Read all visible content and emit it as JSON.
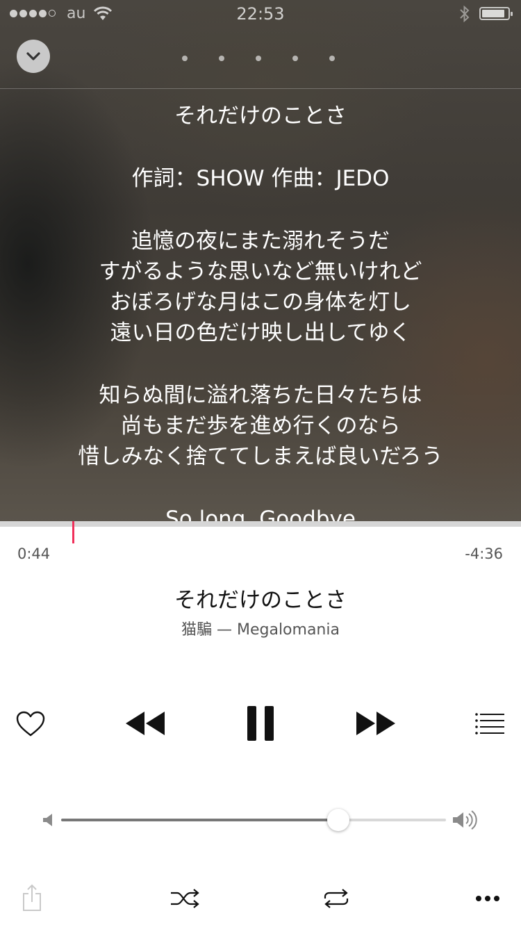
{
  "status_bar": {
    "carrier": "au",
    "time": "22:53",
    "signal_bars_filled": 4,
    "signal_bars_total": 5
  },
  "lyrics": {
    "lines": [
      "それだけのことさ",
      "",
      "作詞：SHOW 作曲：JEDO",
      "",
      "追憶の夜にまた溺れそうだ",
      "すがるような思いなど無いけれど",
      "おぼろげな月はこの身体を灯し",
      "遠い日の色だけ映し出してゆく",
      "",
      "知らぬ間に溢れ落ちた日々たちは",
      "尚もまだ歩を進め行くのなら",
      "惜しみなく捨ててしまえば良いだろう",
      "",
      "So long ,Goodbye"
    ]
  },
  "pager": {
    "pages": 5
  },
  "playback": {
    "elapsed": "0:44",
    "remaining": "-4:36",
    "progress_fraction": 0.138,
    "accent_color": "#f0305a"
  },
  "song": {
    "title": "それだけのことさ",
    "subtitle": "猫騙 — Megalomania"
  },
  "volume": {
    "level_fraction": 0.72
  },
  "icons": {
    "collapse": "chevron-down-icon",
    "love": "heart-icon",
    "previous": "rewind-icon",
    "play_pause": "pause-icon",
    "next": "fast-forward-icon",
    "up_next": "list-icon",
    "volume_low": "speaker-low-icon",
    "volume_high": "speaker-high-icon",
    "share": "share-icon",
    "shuffle": "shuffle-icon",
    "repeat": "repeat-icon",
    "more": "more-icon"
  }
}
